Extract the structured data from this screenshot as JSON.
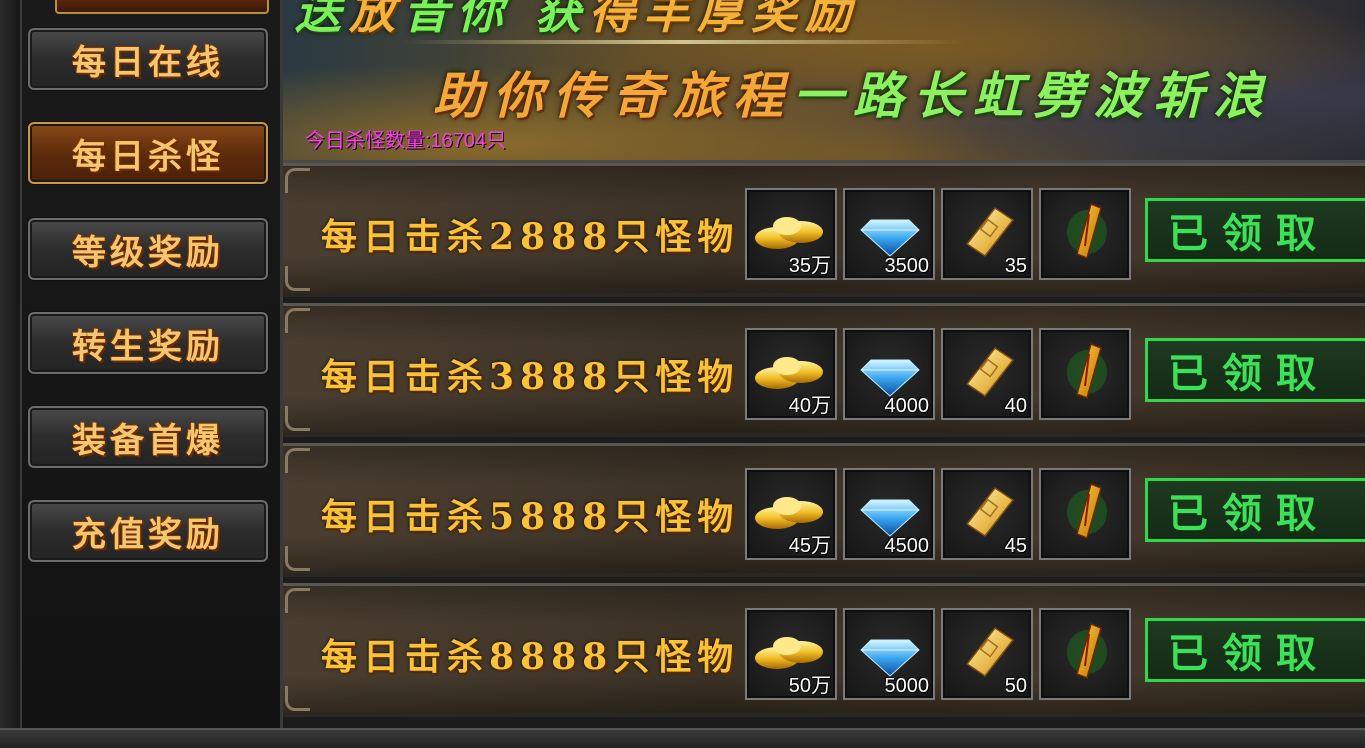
{
  "sidebar": {
    "items": [
      {
        "label": "每日在线",
        "active": false
      },
      {
        "label": "每日杀怪",
        "active": true
      },
      {
        "label": "等级奖励",
        "active": false
      },
      {
        "label": "转生奖励",
        "active": false
      },
      {
        "label": "装备首爆",
        "active": false
      },
      {
        "label": "充值奖励",
        "active": false
      }
    ]
  },
  "banner": {
    "line1_green_a": "送",
    "line1_gold": "放",
    "line1_green_b": "昔",
    "line1_gold2": "你",
    "line1_green_c": "获",
    "line1_gold3": "得丰厚奖励",
    "line2_gold": "助你传奇旅程",
    "line2_green": "一路长虹劈波斩浪",
    "kill_count": "今日杀怪数量:16704只"
  },
  "tasks": [
    {
      "title": "每日击杀2888只怪物",
      "gold": "35万",
      "diamond": "3500",
      "scroll": "35",
      "claim": "已领取"
    },
    {
      "title": "每日击杀3888只怪物",
      "gold": "40万",
      "diamond": "4000",
      "scroll": "40",
      "claim": "已领取"
    },
    {
      "title": "每日击杀5888只怪物",
      "gold": "45万",
      "diamond": "4500",
      "scroll": "45",
      "claim": "已领取"
    },
    {
      "title": "每日击杀8888只怪物",
      "gold": "50万",
      "diamond": "5000",
      "scroll": "50",
      "claim": "已领取"
    }
  ],
  "icons": {
    "gold": "gold-ingot-icon",
    "diamond": "diamond-icon",
    "scroll": "scroll-icon",
    "talisman": "talisman-icon"
  },
  "colors": {
    "title_gold": "#f8c23a",
    "claim_green": "#3ee05a",
    "kill_count_magenta": "#ff3cf0"
  }
}
